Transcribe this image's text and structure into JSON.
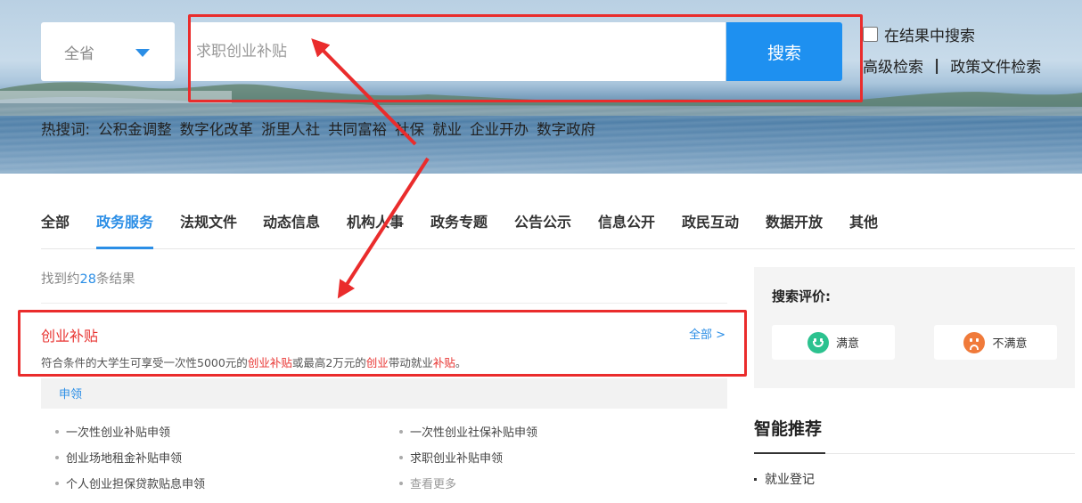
{
  "search": {
    "province": "全省",
    "placeholder": "求职创业补贴",
    "button": "搜索",
    "in_results": "在结果中搜索",
    "advanced": "高级检索",
    "separator": "|",
    "policy_docs": "政策文件检索"
  },
  "hotwords": {
    "label": "热搜词:",
    "items": [
      "公积金调整",
      "数字化改革",
      "浙里人社",
      "共同富裕",
      "社保",
      "就业",
      "企业开办",
      "数字政府"
    ]
  },
  "tabs": [
    "全部",
    "政务服务",
    "法规文件",
    "动态信息",
    "机构人事",
    "政务专题",
    "公告公示",
    "信息公开",
    "政民互动",
    "数据开放",
    "其他"
  ],
  "active_tab": "政务服务",
  "results": {
    "found_prefix": "找到约",
    "count": "28",
    "found_suffix": "条结果",
    "card": {
      "title": "创业补贴",
      "all_link": "全部 >",
      "desc_parts": [
        "符合条件的大学生可享受一次性5000元的",
        "创业补贴",
        "或最高2万元的",
        "创业",
        "带动就业",
        "补贴",
        "。"
      ]
    },
    "apply_label": "申领",
    "links": [
      "一次性创业补贴申领",
      "一次性创业社保补贴申领",
      "创业场地租金补贴申领",
      "求职创业补贴申领",
      "个人创业担保贷款贴息申领"
    ],
    "more": "查看更多"
  },
  "evaluation": {
    "title": "搜索评价:",
    "satisfied": "满意",
    "unsatisfied": "不满意"
  },
  "recommend": {
    "title": "智能推荐",
    "items": [
      "就业登记"
    ]
  },
  "colors": {
    "accent": "#1e90f0",
    "highlight": "#e8322f",
    "annotation": "#ea2c2c"
  }
}
